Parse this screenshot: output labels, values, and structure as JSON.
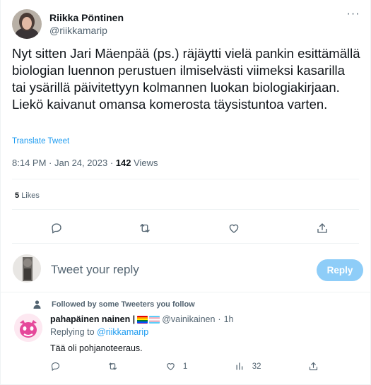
{
  "author": {
    "name": "Riikka Pöntinen",
    "handle": "@riikkamarip"
  },
  "tweet": {
    "text": "Nyt sitten Jari Mäenpää (ps.) räjäytti vielä pankin esittämällä biologian luennon perustuen ilmiselvästi viimeksi kasarilla tai ysärillä päivitettyyn kolmannen luokan biologiakirjaan. Liekö kaivanut omansa komerosta täysistuntoa varten.",
    "translate_label": "Translate Tweet",
    "time": "8:14 PM",
    "date": "Jan 24, 2023",
    "views_count": "142",
    "views_label": "Views",
    "likes_count": "5",
    "likes_label": "Likes"
  },
  "actions": [
    "reply-icon",
    "retweet-icon",
    "like-icon",
    "share-icon"
  ],
  "composer": {
    "placeholder": "Tweet your reply",
    "button_label": "Reply"
  },
  "reply": {
    "context": "Followed by some Tweeters you follow",
    "name": "pahapäinen nainen |",
    "handle": "@vainikainen",
    "time": "1h",
    "replying_prefix": "Replying to",
    "replying_handle": "@riikkamarip",
    "text": "Tää oli pohjanoteeraus.",
    "like_count": "1",
    "views_count": "32"
  },
  "colors": {
    "accent": "#1d9bf0",
    "reply_button_disabled": "#8ecdf8",
    "secondary_text": "#536471",
    "divider": "#eff3f4"
  }
}
